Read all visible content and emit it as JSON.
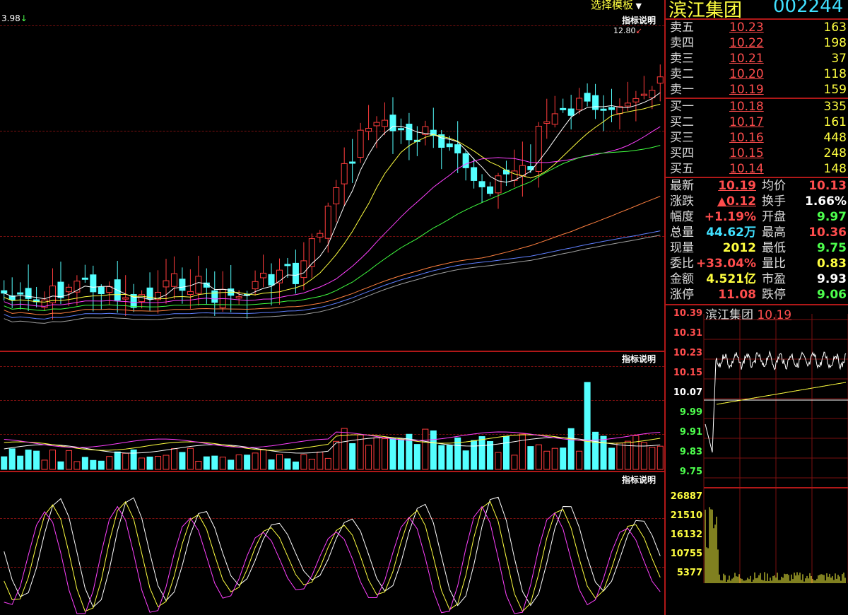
{
  "top": {
    "template_label": "选择模板",
    "stock_name": "滨江集团",
    "stock_code": "002244",
    "low_marker": "3.98",
    "high_marker": "12.80"
  },
  "panels": {
    "price_help": "指标说明",
    "volume_help": "指标说明",
    "indicator_help": "指标说明"
  },
  "order_book": {
    "sells": [
      {
        "label": "卖五",
        "price": "10.23",
        "volume": "163"
      },
      {
        "label": "卖四",
        "price": "10.22",
        "volume": "198"
      },
      {
        "label": "卖三",
        "price": "10.21",
        "volume": "37"
      },
      {
        "label": "卖二",
        "price": "10.20",
        "volume": "118"
      },
      {
        "label": "卖一",
        "price": "10.19",
        "volume": "159"
      }
    ],
    "buys": [
      {
        "label": "买一",
        "price": "10.18",
        "volume": "335"
      },
      {
        "label": "买二",
        "price": "10.17",
        "volume": "161"
      },
      {
        "label": "买三",
        "price": "10.16",
        "volume": "448"
      },
      {
        "label": "买四",
        "price": "10.15",
        "volume": "248"
      },
      {
        "label": "买五",
        "price": "10.14",
        "volume": "148"
      }
    ]
  },
  "stats": [
    {
      "l1": "最新",
      "v1": "10.19",
      "c1": "red",
      "l2": "均价",
      "v2": "10.13",
      "c2": "red"
    },
    {
      "l1": "涨跌",
      "v1": "▲0.12",
      "c1": "red",
      "l2": "换手",
      "v2": "1.66%",
      "c2": "white"
    },
    {
      "l1": "幅度",
      "v1": "+1.19%",
      "c1": "red",
      "l2": "开盘",
      "v2": "9.97",
      "c2": "green"
    },
    {
      "l1": "总量",
      "v1": "44.62万",
      "c1": "cyan",
      "l2": "最高",
      "v2": "10.36",
      "c2": "red"
    },
    {
      "l1": "现量",
      "v1": "2012",
      "c1": "yellow",
      "l2": "最低",
      "v2": "9.75",
      "c2": "green"
    },
    {
      "l1": "委比",
      "v1": "+33.04%",
      "c1": "red",
      "l2": "量比",
      "v2": "0.83",
      "c2": "yellow"
    },
    {
      "l1": "金额",
      "v1": "4.521亿",
      "c1": "yellow",
      "l2": "市盈",
      "v2": "9.93",
      "c2": "white"
    },
    {
      "l1": "涨停",
      "v1": "11.08",
      "c1": "red",
      "l2": "跌停",
      "v2": "9.06",
      "c2": "green"
    }
  ],
  "intraday": {
    "title": "滨江集团",
    "price": "10.19",
    "price_ticks": [
      "10.39",
      "10.31",
      "10.23",
      "10.15",
      "10.07",
      "9.99",
      "9.91",
      "9.83",
      "9.75"
    ],
    "volume_ticks": [
      "26887",
      "21510",
      "16132",
      "10755",
      "5377"
    ]
  },
  "colors": {
    "up": "#ff3c3c",
    "down": "#54ffff",
    "grid": "#7a1010",
    "frame": "#b01818"
  }
}
